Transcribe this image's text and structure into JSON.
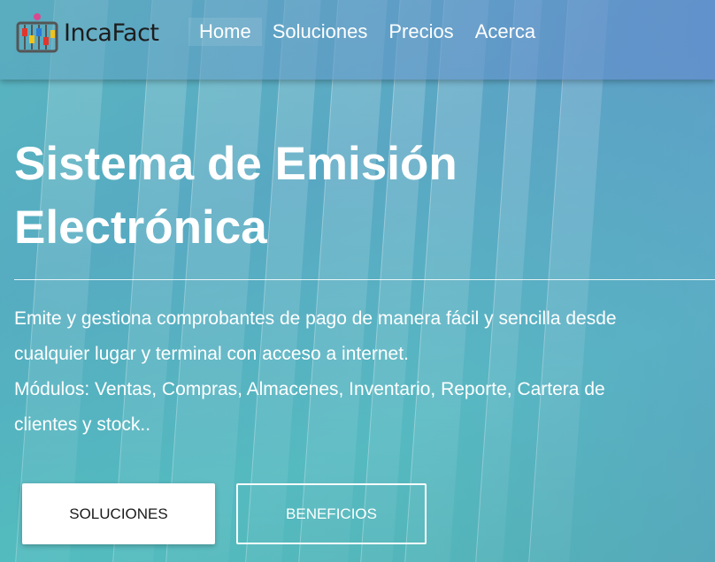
{
  "brand": {
    "name": "IncaFact",
    "logo_icon": "abacus-icon"
  },
  "nav": {
    "items": [
      {
        "label": "Home",
        "active": true
      },
      {
        "label": "Soluciones"
      },
      {
        "label": "Precios"
      },
      {
        "label": "Acerca"
      }
    ]
  },
  "hero": {
    "title_line1": "Sistema de Emisión",
    "title_line2": "Electrónica",
    "desc_line1": "Emite y gestiona comprobantes de pago de manera fácil y sencilla desde",
    "desc_line2": "cualquier lugar y terminal con acceso a internet.",
    "desc_line3": "Módulos: Ventas, Compras, Almacenes, Inventario, Reporte, Cartera de",
    "desc_line4": "clientes y stock..",
    "primary_button": "SOLUCIONES",
    "secondary_button": "BENEFICIOS"
  },
  "colors": {
    "accent_teal": "#56bfc0",
    "accent_blue": "#6490cd",
    "text_light": "#ffffff"
  }
}
